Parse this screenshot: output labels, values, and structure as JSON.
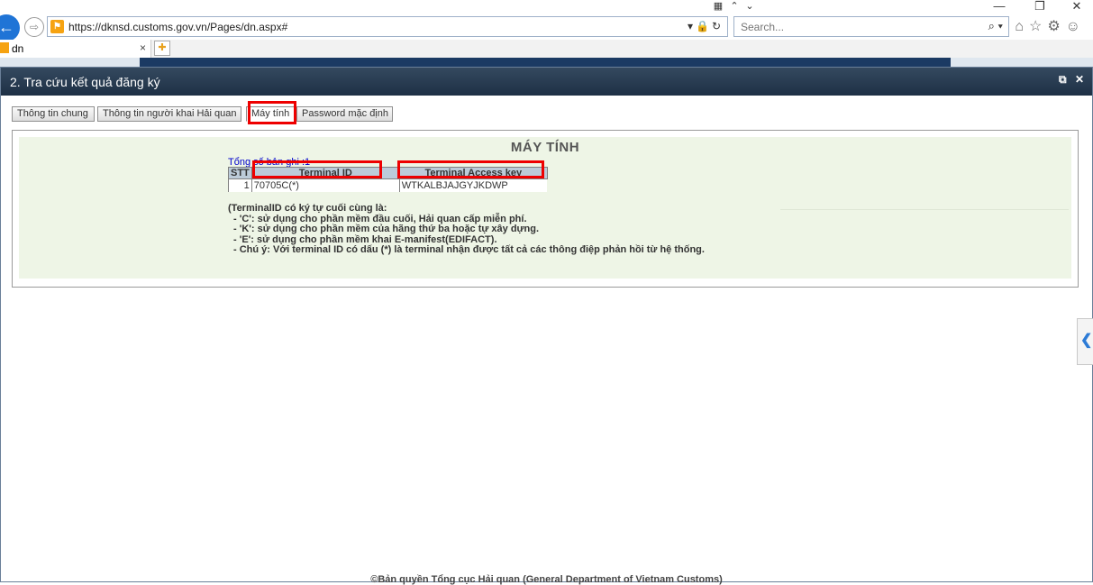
{
  "browser": {
    "url": "https://dknsd.customs.gov.vn/Pages/dn.aspx#",
    "search_placeholder": "Search...",
    "tab_title": "dn",
    "tab_close": "×",
    "window_close": "✕",
    "window_restore": "❐",
    "window_minimize": "—"
  },
  "dialog": {
    "title": "2. Tra cứu kết quả đăng ký",
    "tabs": [
      {
        "label": "Thông tin chung"
      },
      {
        "label": "Thông tin người khai Hải quan"
      },
      {
        "label": "Máy tính"
      },
      {
        "label": "Password mặc định"
      }
    ],
    "active_tab": "Máy tính"
  },
  "content": {
    "section_title": "MÁY TÍNH",
    "total_records": "Tổng số bản ghi :1",
    "table": {
      "headers": [
        "STT",
        "Terminal ID",
        "Terminal Access key"
      ],
      "rows": [
        [
          "1",
          "70705C(*)",
          "WTKALBJAJGYJKDWP"
        ]
      ]
    },
    "notes": [
      "(TerminalID có ký tự cuối cùng là:",
      "  - 'C': sử dụng cho phần mềm đầu cuối, Hải quan cấp miễn phí.",
      "  - 'K': sử dụng cho phần mềm của hãng thứ ba hoặc tự xây dựng.",
      "  - 'E': sử dụng cho phần mềm khai E-manifest(EDIFACT).",
      "  - Chú ý: Với terminal ID có dấu (*) là terminal nhận được tất cả các thông điệp phản hồi từ hệ thống."
    ]
  },
  "footer": "©Bản quyền Tổng cục Hải quan (General Department of Vietnam Customs)",
  "colors": {
    "header_bg": "#1e3045",
    "content_bg": "#eef5e6",
    "highlight": "#e00000",
    "table_header_bg": "#bccbd9"
  }
}
